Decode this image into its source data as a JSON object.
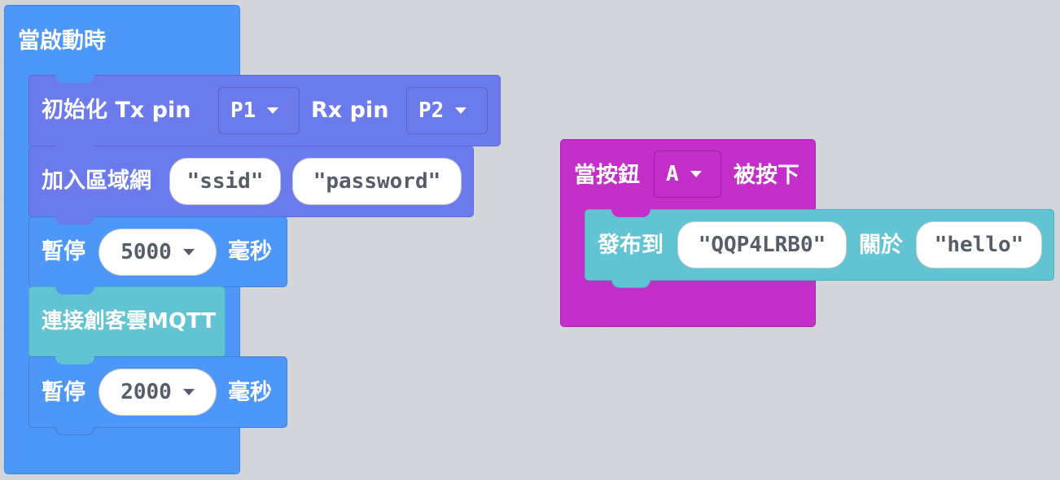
{
  "workspace": {
    "background": "#eef0f2"
  },
  "colors": {
    "basic_blue": "#4c97f7",
    "esp_purple": "#6c7bec",
    "mqtt_teal": "#62c3d3",
    "input_magenta": "#c42fc9"
  },
  "on_start_stack": {
    "hat_label": "當啟動時",
    "init_block": {
      "label_prefix": "初始化 Tx pin",
      "tx_pin": "P1",
      "rx_label": "Rx pin",
      "rx_pin": "P2"
    },
    "wifi_block": {
      "label": "加入區域網",
      "ssid": "ssid",
      "password": "password"
    },
    "pause_block_1": {
      "label": "暫停",
      "value": "5000",
      "unit": "毫秒"
    },
    "connect_block": {
      "label": "連接創客雲MQTT"
    },
    "pause_block_2": {
      "label": "暫停",
      "value": "2000",
      "unit": "毫秒"
    }
  },
  "button_stack": {
    "hat_label_prefix": "當按鈕",
    "button": "A",
    "hat_label_suffix": "被按下",
    "publish_block": {
      "label": "發布到",
      "topic": "QQP4LRB0",
      "about_label": "關於",
      "message": "hello"
    }
  }
}
